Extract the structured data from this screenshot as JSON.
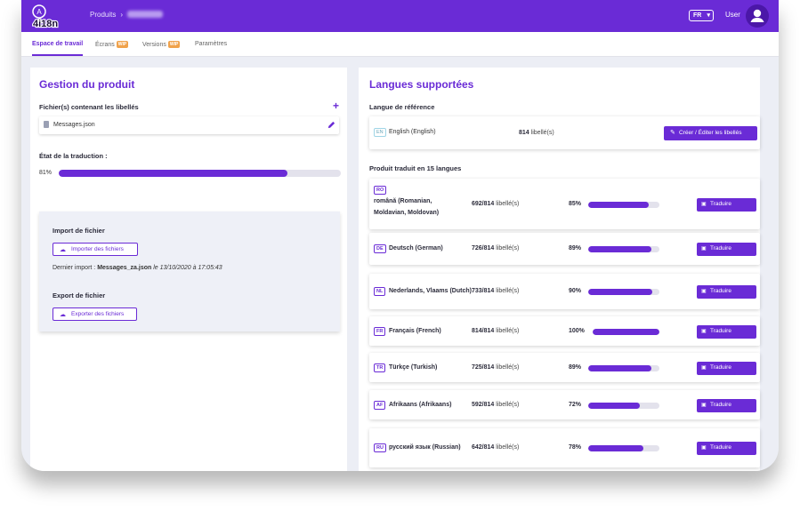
{
  "brand": {
    "logo_text": "4i18n",
    "logo_badge": "A",
    "accent": "#6a2bd6"
  },
  "header": {
    "breadcrumb_root": "Produits",
    "breadcrumb_sep": "›",
    "breadcrumb_product": "CHEF CHA",
    "language": "FR",
    "user": "User"
  },
  "tabs": [
    {
      "label": "Espace de travail",
      "active": true
    },
    {
      "label": "Écrans",
      "badge": "WIP"
    },
    {
      "label": "Versions",
      "badge": "WIP"
    },
    {
      "label": "Paramètres"
    }
  ],
  "left": {
    "title": "Gestion du produit",
    "files_label": "Fichier(s) contenant les libellés",
    "file_name": "Messages.json",
    "state_label": "État de la traduction :",
    "progress": {
      "value": 81,
      "text": "81%"
    },
    "import_title": "Import de fichier",
    "import_button": "Importer des fichiers",
    "last_import_label": "Dernier import :",
    "last_import_file": "Messages_za.json",
    "last_import_date": "le 13/10/2020 à 17:05:43",
    "export_title": "Export de fichier",
    "export_button": "Exporter des fichiers"
  },
  "right": {
    "title": "Langues supportées",
    "ref_label": "Langue de référence",
    "ref": {
      "code": "EN",
      "name": "English (English)",
      "count": "814",
      "count_suffix": "libellé(s)",
      "button": "Créer / Éditer les libellés"
    },
    "translated_label": "Produit traduit en 15 langues",
    "translate_button": "Traduire",
    "languages": [
      {
        "code": "RO",
        "name1": "română (Romanian,",
        "name2": "Moldavian, Moldovan)",
        "count": "692/814",
        "suffix": "libellé(s)",
        "pct": 85,
        "pct_text": "85%"
      },
      {
        "code": "DE",
        "name1": "Deutsch (German)",
        "name2": "",
        "count": "726/814",
        "suffix": "libellé(s)",
        "pct": 89,
        "pct_text": "89%"
      },
      {
        "code": "NL",
        "name1": "Nederlands, Vlaams (Dutch)",
        "name2": "",
        "count": "733/814",
        "suffix": "libellé(s)",
        "pct": 90,
        "pct_text": "90%"
      },
      {
        "code": "FR",
        "name1": "Français (French)",
        "name2": "",
        "count": "814/814",
        "suffix": "libellé(s)",
        "pct": 100,
        "pct_text": "100%"
      },
      {
        "code": "TR",
        "name1": "Türkçe (Turkish)",
        "name2": "",
        "count": "725/814",
        "suffix": "libellé(s)",
        "pct": 89,
        "pct_text": "89%"
      },
      {
        "code": "AF",
        "name1": "Afrikaans (Afrikaans)",
        "name2": "",
        "count": "592/814",
        "suffix": "libellé(s)",
        "pct": 72,
        "pct_text": "72%"
      },
      {
        "code": "RU",
        "name1": "русский язык (Russian)",
        "name2": "",
        "count": "642/814",
        "suffix": "libellé(s)",
        "pct": 78,
        "pct_text": "78%"
      }
    ]
  }
}
